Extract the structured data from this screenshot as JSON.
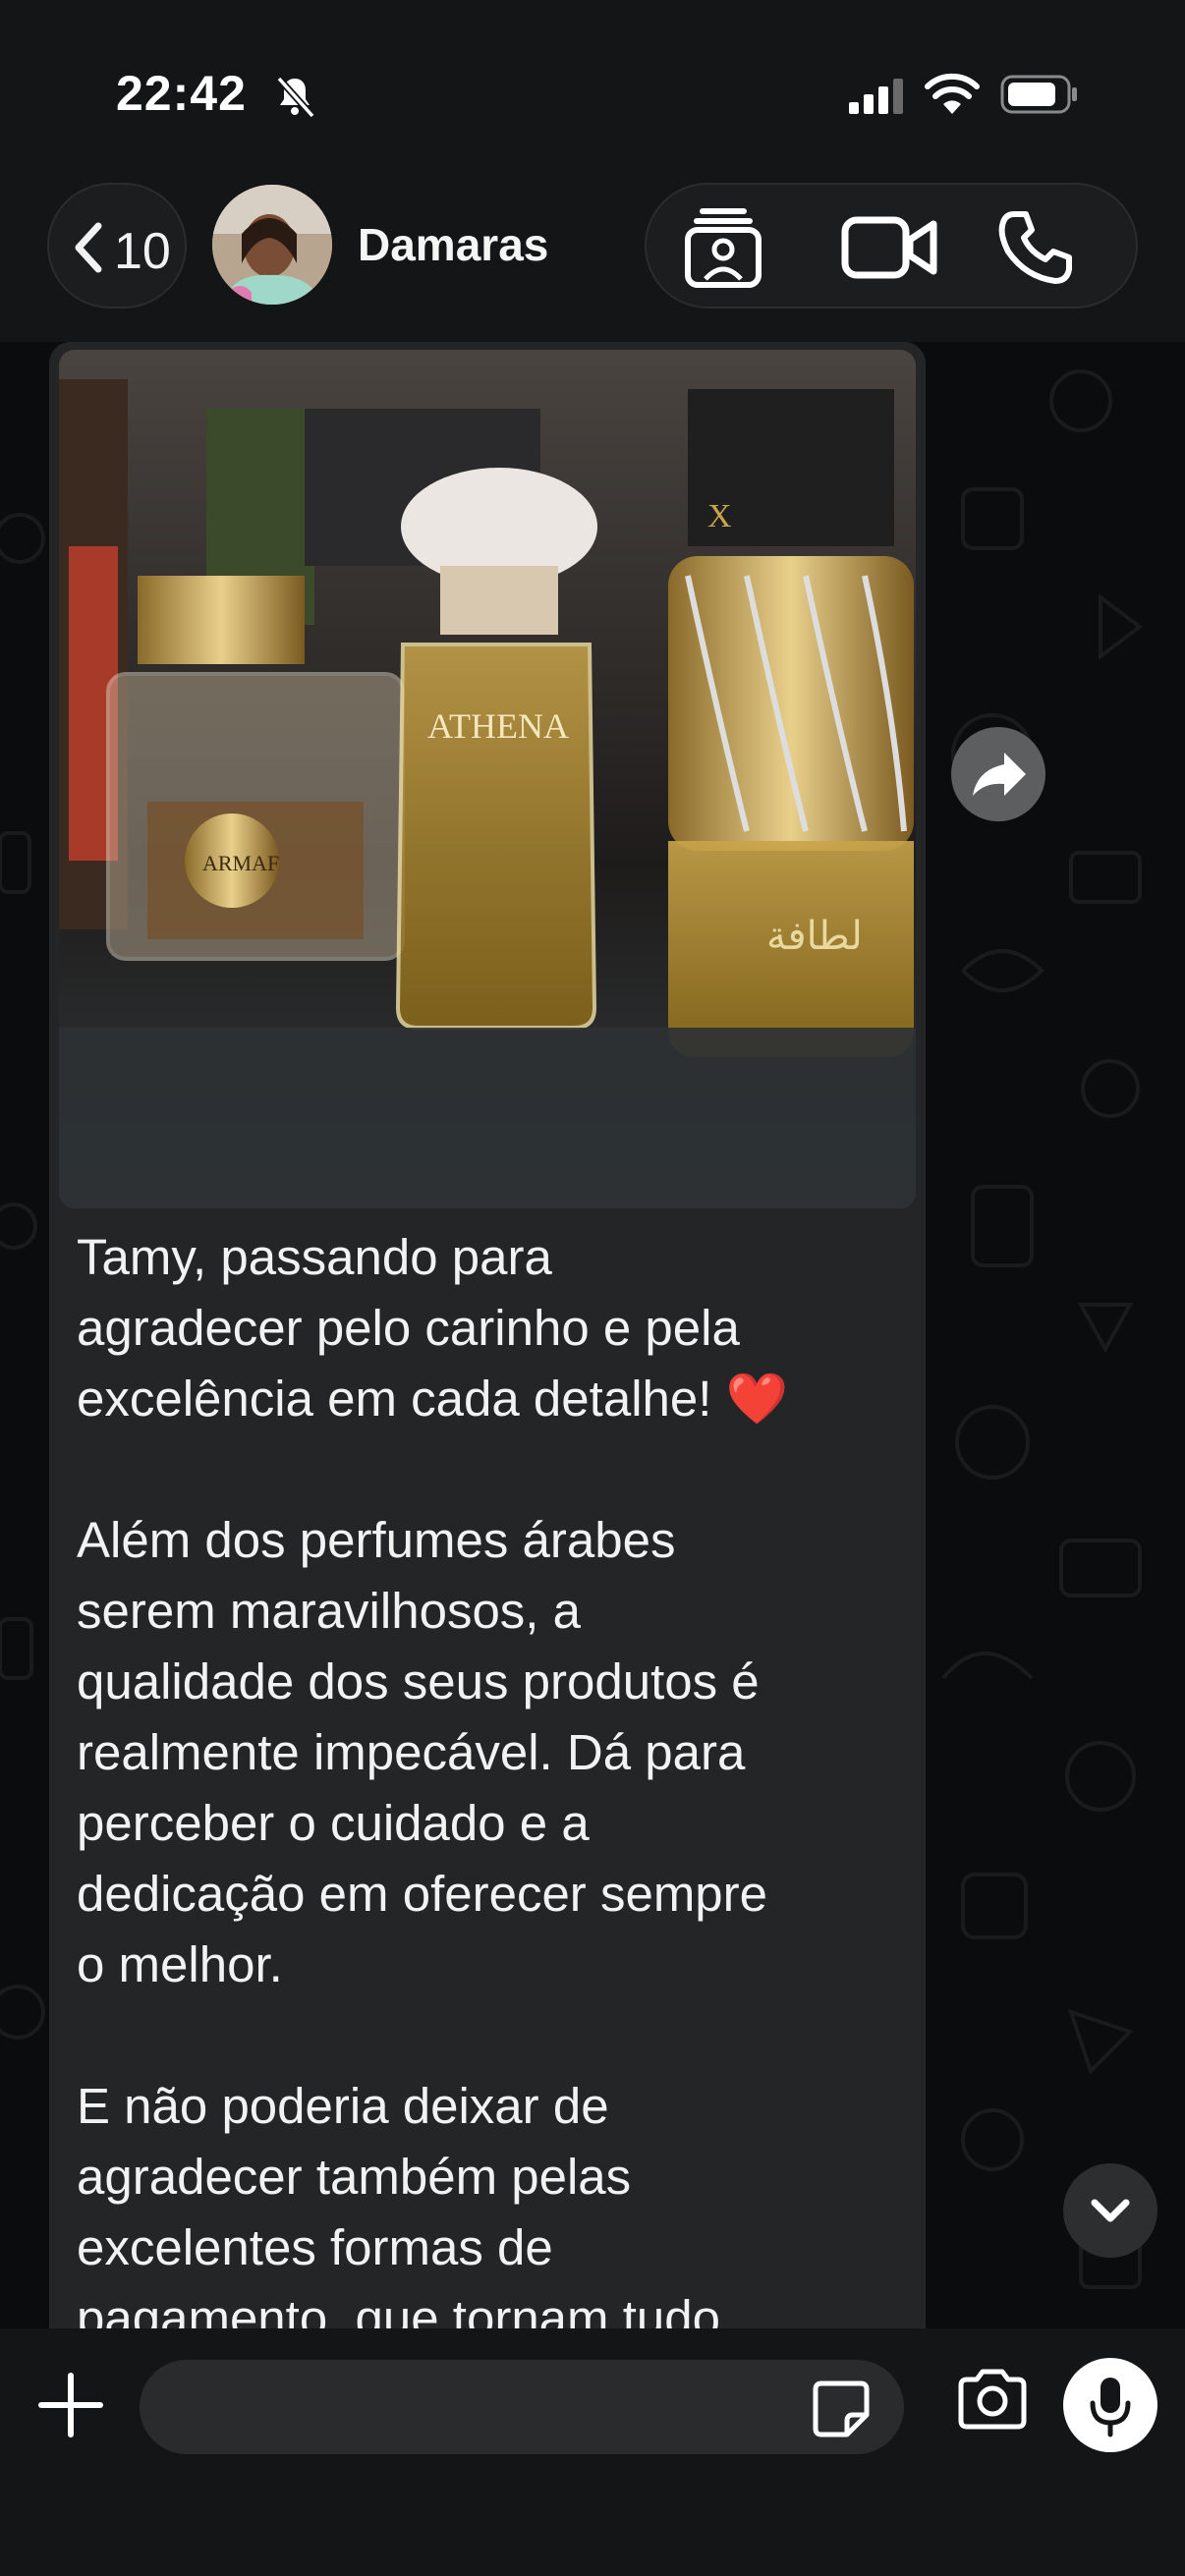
{
  "status_bar": {
    "time": "22:42",
    "icons": [
      "bell-slash-icon",
      "cellular-signal-icon",
      "wifi-icon",
      "battery-icon"
    ]
  },
  "header": {
    "back_count": "10",
    "contact_name": "Damaras",
    "action_icons": [
      "contact-card-icon",
      "video-call-icon",
      "voice-call-icon"
    ]
  },
  "message": {
    "image_caption_text": [
      "ARMAF",
      "ATHENA",
      "لطافة"
    ],
    "text": "Tamy, passando para\nagradecer pelo carinho e pela\nexcelência em cada detalhe! ❤️\n\nAlém dos perfumes árabes\nserem maravilhosos, a\nqualidade dos seus produtos é\nrealmente impecável. Dá para\nperceber o cuidado e a\ndedicação em oferecer sempre\no melhor.\n\nE não poderia deixar de\nagradecer também pelas\nexcelentes formas de\npagamento, que tornam tudo"
  },
  "input_bar": {
    "placeholder": "",
    "icons": [
      "plus-icon",
      "sticker-icon",
      "camera-icon",
      "microphone-icon"
    ]
  },
  "colors": {
    "background": "#0b0c0d",
    "bar": "#141516",
    "bubble": "#232526",
    "heart": "#e0242e"
  }
}
